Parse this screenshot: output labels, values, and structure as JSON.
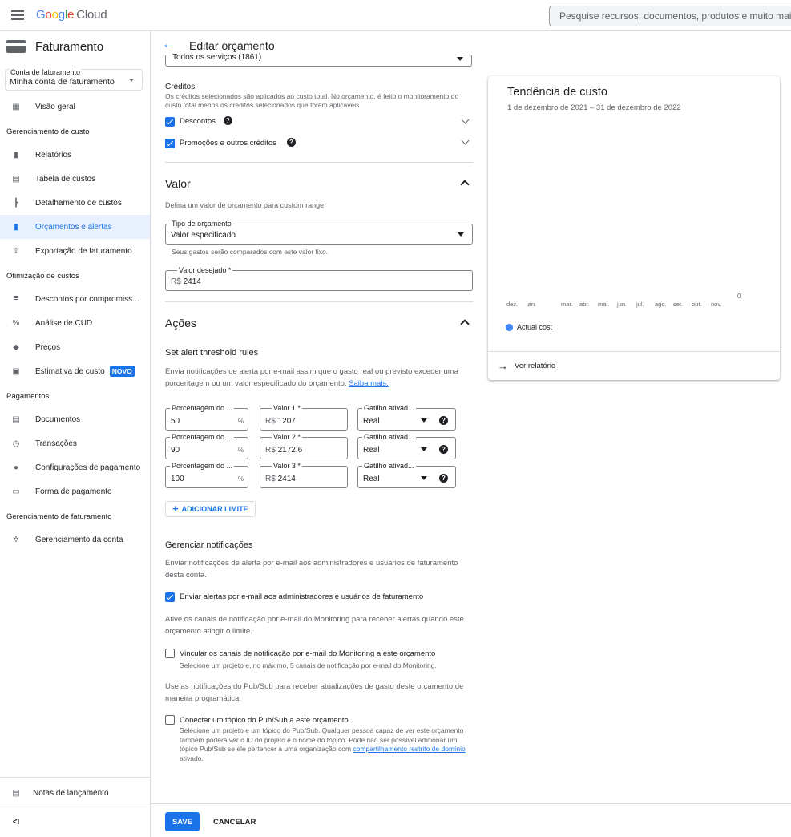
{
  "topbar": {
    "logo_g": "G",
    "logo_o1": "o",
    "logo_o2": "o",
    "logo_g2": "g",
    "logo_l": "l",
    "logo_e": "e",
    "logo_cloud": "Cloud",
    "search_placeholder": "Pesquise recursos, documentos, produtos e muito mais"
  },
  "sidebar": {
    "title": "Faturamento",
    "account_label": "Conta de faturamento",
    "account_value": "Minha conta de faturamento",
    "overview": "Visão geral",
    "sec_cost_mgmt": "Gerenciamento de custo",
    "reports": "Relatórios",
    "cost_table": "Tabela de custos",
    "cost_breakdown": "Detalhamento de custos",
    "budgets": "Orçamentos e alertas",
    "export": "Exportação de faturamento",
    "sec_cost_opt": "Otimização de custos",
    "commit_discounts": "Descontos por compromiss...",
    "cud_analysis": "Análise de CUD",
    "pricing": "Preços",
    "cost_estimate": "Estimativa de custo",
    "new_badge": "NOVO",
    "sec_payments": "Pagamentos",
    "documents": "Documentos",
    "transactions": "Transações",
    "payment_settings": "Configurações de pagamento",
    "payment_method": "Forma de pagamento",
    "sec_billing_mgmt": "Gerenciamento de faturamento",
    "account_mgmt": "Gerenciamento da conta",
    "release_notes": "Notas de lançamento",
    "collapse": "<I"
  },
  "header": {
    "title": "Editar orçamento"
  },
  "form": {
    "services_value": "Todos os serviços (1861)",
    "credits_title": "Créditos",
    "credits_desc": "Os créditos selecionados são aplicados ao custo total. No orçamento, é feito o monitoramento do custo total menos os créditos selecionados que forem aplicáveis",
    "discounts": "Descontos",
    "promotions": "Promoções e outros créditos",
    "amount_title": "Valor",
    "amount_desc": "Defina um valor de orçamento para custom range",
    "budget_type_label": "Tipo de orçamento",
    "budget_type_value": "Valor especificado",
    "budget_type_hint": "Seus gastos serão comparados com este valor fixo.",
    "target_label": "Valor desejado *",
    "currency": "R$",
    "target_value": "2414",
    "actions_title": "Ações",
    "threshold_title": "Set alert threshold rules",
    "threshold_desc": "Envia notificações de alerta por e-mail assim que o gasto real ou previsto exceder uma porcentagem ou um valor especificado do orçamento.",
    "learn_more": "Saiba mais.",
    "thresholds": [
      {
        "pct_label": "Porcentagem do ...",
        "pct": "50",
        "pct_suffix": "%",
        "amt_label": "Valor 1 *",
        "amt": "1207",
        "trig_label": "Gatilho ativad...",
        "trig": "Real"
      },
      {
        "pct_label": "Porcentagem do ...",
        "pct": "90",
        "pct_suffix": "%",
        "amt_label": "Valor 2 *",
        "amt": "2172,6",
        "trig_label": "Gatilho ativad...",
        "trig": "Real"
      },
      {
        "pct_label": "Porcentagem do ...",
        "pct": "100",
        "pct_suffix": "%",
        "amt_label": "Valor 3 *",
        "amt": "2414",
        "trig_label": "Gatilho ativad...",
        "trig": "Real"
      }
    ],
    "add_threshold": "ADICIONAR LIMITE",
    "notif_title": "Gerenciar notificações",
    "notif_desc": "Enviar notificações de alerta por e-mail aos administradores e usuários de faturamento desta conta.",
    "notif_email": "Enviar alertas por e-mail aos administradores e usuários de faturamento",
    "monitoring_desc": "Ative os canais de notificação por e-mail do Monitoring para receber alertas quando este orçamento atingir o limite.",
    "monitoring_link": "Vincular os canais de notificação por e-mail do Monitoring a este orçamento",
    "monitoring_hint": "Selecione um projeto e, no máximo, 5 canais de notificação por e-mail do Monitoring.",
    "pubsub_desc": "Use as notificações do Pub/Sub para receber atualizações de gasto deste orçamento de maneira programática.",
    "pubsub_connect": "Conectar um tópico do Pub/Sub a este orçamento",
    "pubsub_hint": "Selecione um projeto e um tópico do Pub/Sub. Qualquer pessoa capaz de ver este orçamento também poderá ver o ID do projeto e o nome do tópico. Pode não ser possível adicionar um tópico Pub/Sub se ele pertencer a uma organização com",
    "pubsub_hint_link": "compartilhamento restrito de domínio",
    "pubsub_hint_end": "ativado."
  },
  "chart_data": {
    "type": "line",
    "title": "Tendência de custo",
    "subtitle": "1 de dezembro de 2021 – 31 de dezembro de 2022",
    "categories": [
      "dez.",
      "jan.",
      "mar.",
      "abr.",
      "mai.",
      "jun.",
      "jul.",
      "ago.",
      "set.",
      "out.",
      "nov."
    ],
    "y_tick": "0",
    "series": [
      {
        "name": "Actual cost",
        "values": []
      }
    ],
    "colors": {
      "actual": "#4285f4"
    },
    "link": "Ver relatório"
  },
  "footer": {
    "save": "SAVE",
    "cancel": "CANCELAR"
  },
  "colors": {
    "accent": "#1a73e8",
    "active_bg": "#e8f0fe"
  }
}
